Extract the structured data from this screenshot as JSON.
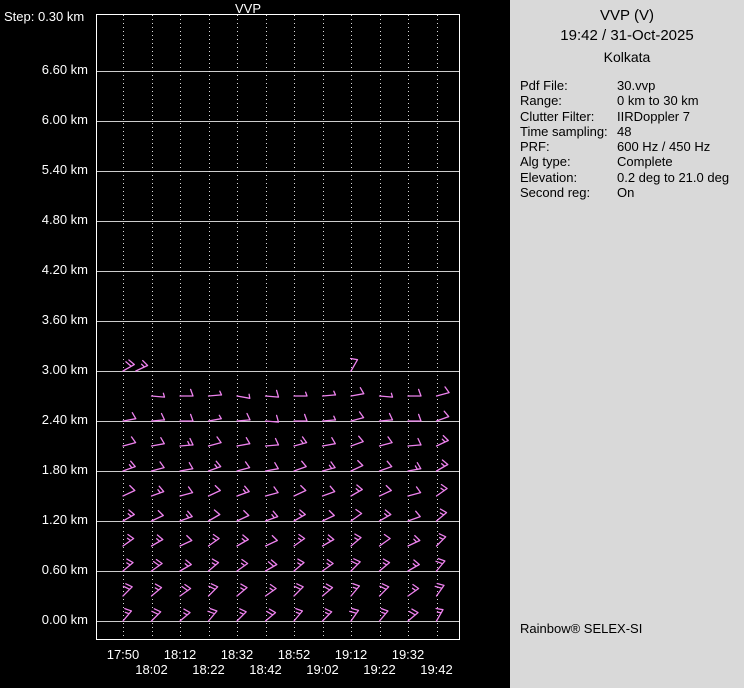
{
  "colors": {
    "background": "#000000",
    "panel_background": "#d9d9d9",
    "grid": "#ffffff",
    "barb": "#ee82ee",
    "plot_text": "#ffffff",
    "panel_text": "#000000"
  },
  "panel": {
    "title": "VVP (V)",
    "datetime": "19:42 / 31-Oct-2025",
    "site": "Kolkata",
    "fields": [
      {
        "label": "Pdf File:",
        "value": "30.vvp"
      },
      {
        "label": "Range:",
        "value": "0 km to 30 km"
      },
      {
        "label": "Clutter Filter:",
        "value": "IIRDoppler 7"
      },
      {
        "label": "Time sampling:",
        "value": "48"
      },
      {
        "label": "PRF:",
        "value": "600 Hz / 450 Hz"
      },
      {
        "label": "Alg type:",
        "value": "Complete"
      },
      {
        "label": "Elevation:",
        "value": "0.2 deg to 21.0 deg"
      },
      {
        "label": "Second reg:",
        "value": "On"
      }
    ],
    "branding": "Rainbow® SELEX-SI"
  },
  "chart_data": {
    "type": "wind-barb-time-height-profile",
    "title": "VVP",
    "step_label": "Step: 0.30 km",
    "y_axis": {
      "label_unit": "km",
      "height_step_km": 0.3,
      "tick_step_km": 0.6,
      "min_km": 0.0,
      "max_tick_km": 6.6
    },
    "y_tick_labels": [
      "6.60 km",
      "6.00 km",
      "5.40 km",
      "4.80 km",
      "4.20 km",
      "3.60 km",
      "3.00 km",
      "2.40 km",
      "1.80 km",
      "1.20 km",
      "0.60 km",
      "0.00 km"
    ],
    "x_tick_labels": [
      "17:50",
      "18:02",
      "18:12",
      "18:22",
      "18:32",
      "18:42",
      "18:52",
      "19:02",
      "19:12",
      "19:22",
      "19:32",
      "19:42"
    ],
    "grid": {
      "vertical": "dotted",
      "horizontal": "solid"
    },
    "barb_units": "knots",
    "barbs": [
      {
        "height_km": 3.0,
        "cells": [
          [
            0,
            60,
            20
          ],
          [
            0.45,
            65,
            15
          ],
          [
            8,
            30,
            10
          ]
        ]
      },
      {
        "height_km": 2.7,
        "cells": [
          [
            1,
            95,
            5
          ],
          [
            2,
            90,
            10
          ],
          [
            3,
            85,
            5
          ],
          [
            4,
            100,
            5
          ],
          [
            5,
            95,
            10
          ],
          [
            6,
            90,
            5
          ],
          [
            7,
            85,
            5
          ],
          [
            8,
            80,
            10
          ],
          [
            9,
            95,
            5
          ],
          [
            10,
            90,
            10
          ],
          [
            11,
            75,
            10
          ]
        ]
      },
      {
        "height_km": 2.4,
        "cells": [
          [
            0,
            80,
            10
          ],
          [
            1,
            85,
            10
          ],
          [
            2,
            90,
            10
          ],
          [
            3,
            80,
            5
          ],
          [
            4,
            85,
            10
          ],
          [
            5,
            95,
            10
          ],
          [
            6,
            90,
            10
          ],
          [
            7,
            85,
            5
          ],
          [
            8,
            75,
            10
          ],
          [
            9,
            85,
            10
          ],
          [
            10,
            90,
            10
          ],
          [
            11,
            70,
            10
          ]
        ]
      },
      {
        "height_km": 2.1,
        "cells": [
          [
            0,
            75,
            10
          ],
          [
            1,
            80,
            10
          ],
          [
            2,
            85,
            15
          ],
          [
            3,
            75,
            10
          ],
          [
            4,
            80,
            10
          ],
          [
            5,
            85,
            10
          ],
          [
            6,
            75,
            15
          ],
          [
            7,
            80,
            10
          ],
          [
            8,
            70,
            10
          ],
          [
            9,
            75,
            10
          ],
          [
            10,
            85,
            10
          ],
          [
            11,
            65,
            15
          ]
        ]
      },
      {
        "height_km": 1.8,
        "cells": [
          [
            0,
            70,
            15
          ],
          [
            1,
            75,
            10
          ],
          [
            2,
            80,
            10
          ],
          [
            3,
            70,
            15
          ],
          [
            4,
            75,
            10
          ],
          [
            5,
            80,
            10
          ],
          [
            6,
            70,
            10
          ],
          [
            7,
            75,
            15
          ],
          [
            8,
            65,
            10
          ],
          [
            9,
            70,
            10
          ],
          [
            10,
            80,
            15
          ],
          [
            11,
            60,
            15
          ]
        ]
      },
      {
        "height_km": 1.5,
        "cells": [
          [
            0,
            65,
            10
          ],
          [
            1,
            70,
            15
          ],
          [
            2,
            75,
            10
          ],
          [
            3,
            65,
            10
          ],
          [
            4,
            70,
            15
          ],
          [
            5,
            75,
            10
          ],
          [
            6,
            65,
            10
          ],
          [
            7,
            70,
            10
          ],
          [
            8,
            60,
            15
          ],
          [
            9,
            65,
            10
          ],
          [
            10,
            75,
            10
          ],
          [
            11,
            55,
            15
          ]
        ]
      },
      {
        "height_km": 1.2,
        "cells": [
          [
            0,
            60,
            15
          ],
          [
            1,
            65,
            10
          ],
          [
            2,
            70,
            15
          ],
          [
            3,
            60,
            10
          ],
          [
            4,
            65,
            10
          ],
          [
            5,
            70,
            15
          ],
          [
            6,
            60,
            15
          ],
          [
            7,
            65,
            10
          ],
          [
            8,
            55,
            10
          ],
          [
            9,
            60,
            15
          ],
          [
            10,
            70,
            10
          ],
          [
            11,
            50,
            15
          ]
        ]
      },
      {
        "height_km": 0.9,
        "cells": [
          [
            0,
            55,
            15
          ],
          [
            1,
            60,
            15
          ],
          [
            2,
            65,
            10
          ],
          [
            3,
            55,
            15
          ],
          [
            4,
            60,
            15
          ],
          [
            5,
            65,
            10
          ],
          [
            6,
            55,
            15
          ],
          [
            7,
            60,
            15
          ],
          [
            8,
            50,
            15
          ],
          [
            9,
            55,
            10
          ],
          [
            10,
            65,
            15
          ],
          [
            11,
            45,
            15
          ]
        ]
      },
      {
        "height_km": 0.6,
        "cells": [
          [
            0,
            50,
            15
          ],
          [
            1,
            55,
            20
          ],
          [
            2,
            60,
            15
          ],
          [
            3,
            50,
            15
          ],
          [
            4,
            55,
            15
          ],
          [
            5,
            60,
            20
          ],
          [
            6,
            50,
            15
          ],
          [
            7,
            55,
            15
          ],
          [
            8,
            45,
            20
          ],
          [
            9,
            50,
            15
          ],
          [
            10,
            60,
            15
          ],
          [
            11,
            40,
            20
          ]
        ]
      },
      {
        "height_km": 0.3,
        "cells": [
          [
            0,
            45,
            20
          ],
          [
            1,
            50,
            15
          ],
          [
            2,
            55,
            20
          ],
          [
            3,
            45,
            20
          ],
          [
            4,
            50,
            15
          ],
          [
            5,
            55,
            15
          ],
          [
            6,
            45,
            20
          ],
          [
            7,
            50,
            20
          ],
          [
            8,
            40,
            15
          ],
          [
            9,
            45,
            20
          ],
          [
            10,
            55,
            15
          ],
          [
            11,
            35,
            20
          ]
        ]
      },
      {
        "height_km": 0.0,
        "cells": [
          [
            0,
            40,
            15
          ],
          [
            1,
            45,
            20
          ],
          [
            2,
            50,
            15
          ],
          [
            3,
            40,
            20
          ],
          [
            4,
            45,
            15
          ],
          [
            5,
            50,
            20
          ],
          [
            6,
            40,
            15
          ],
          [
            7,
            45,
            15
          ],
          [
            8,
            35,
            20
          ],
          [
            9,
            40,
            15
          ],
          [
            10,
            50,
            20
          ],
          [
            11,
            30,
            15
          ]
        ]
      }
    ]
  }
}
